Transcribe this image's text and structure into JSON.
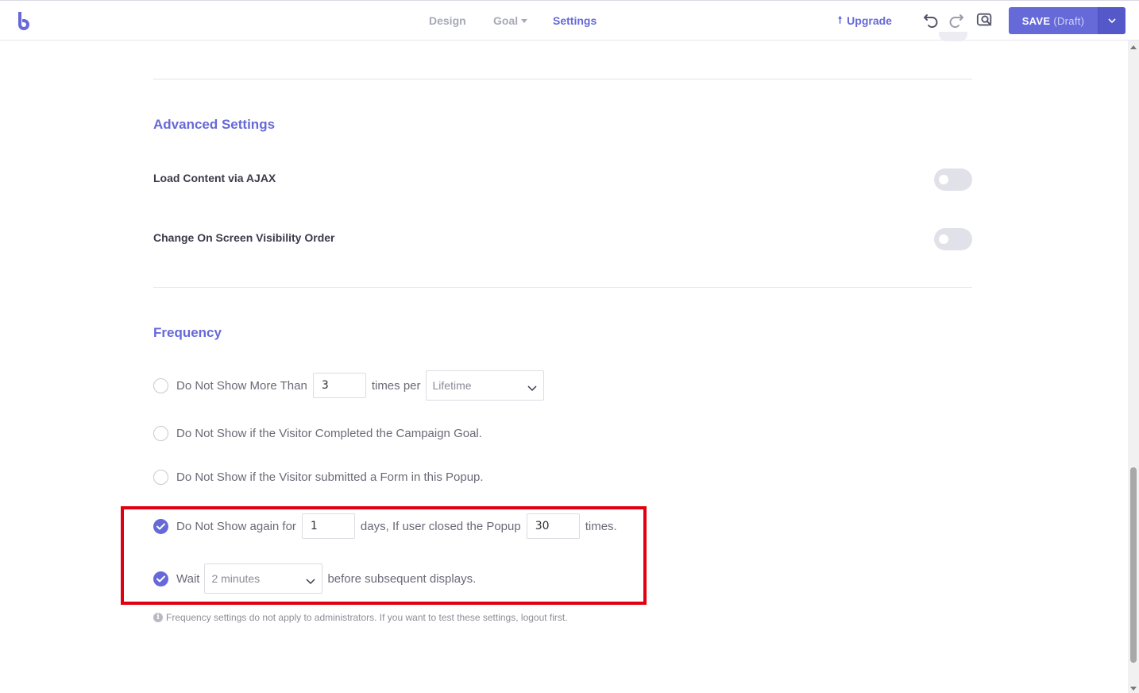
{
  "header": {
    "nav": {
      "design": "Design",
      "goal": "Goal",
      "settings": "Settings"
    },
    "upgrade_label": "Upgrade",
    "save_label": "SAVE",
    "save_status": "(Draft)",
    "accent_color": "#6669d8"
  },
  "advanced": {
    "title": "Advanced Settings",
    "items": [
      {
        "label": "Load Content via AJAX",
        "enabled": false
      },
      {
        "label": "Change On Screen Visibility Order",
        "enabled": false
      }
    ]
  },
  "frequency": {
    "title": "Frequency",
    "max_times": {
      "text_before": "Do Not Show More Than",
      "value": "3",
      "text_mid": "times per",
      "period": "Lifetime",
      "checked": false
    },
    "goal_completed": {
      "text": "Do Not Show if the Visitor Completed the Campaign Goal.",
      "checked": false
    },
    "form_submitted": {
      "text": "Do Not Show if the Visitor submitted a Form in this Popup.",
      "checked": false
    },
    "closed_rule": {
      "text_before": "Do Not Show again for",
      "days": "1",
      "text_mid": "days, If user closed the Popup",
      "times": "30",
      "text_after": "times.",
      "checked": true
    },
    "wait_rule": {
      "text_before": "Wait",
      "interval": "2 minutes",
      "text_after": "before subsequent displays.",
      "checked": true
    },
    "note": "Frequency settings do not apply to administrators. If you want to test these settings, logout first."
  }
}
